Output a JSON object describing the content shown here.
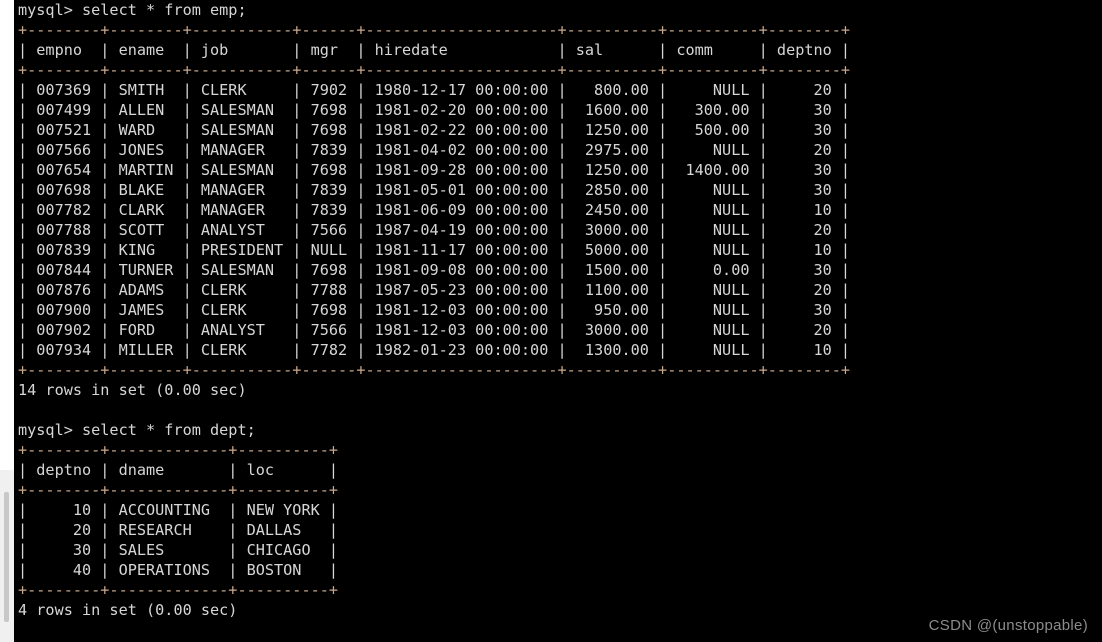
{
  "terminal": {
    "prompt": "mysql> ",
    "queries": {
      "emp": "select * from emp;",
      "dept": "select * from dept;"
    },
    "status": {
      "emp": "14 rows in set (0.00 sec)",
      "dept": "4 rows in set (0.00 sec)"
    }
  },
  "emp_table": {
    "columns": [
      "empno",
      "ename",
      "job",
      "mgr",
      "hiredate",
      "sal",
      "comm",
      "deptno"
    ],
    "widths": [
      8,
      8,
      11,
      6,
      21,
      10,
      10,
      8
    ],
    "align": [
      "right",
      "left",
      "left",
      "right",
      "left",
      "right",
      "right",
      "right"
    ],
    "rows": [
      {
        "empno": "007369",
        "ename": "SMITH",
        "job": "CLERK",
        "mgr": "7902",
        "hiredate": "1980-12-17 00:00:00",
        "sal": "800.00",
        "comm": "NULL",
        "deptno": "20"
      },
      {
        "empno": "007499",
        "ename": "ALLEN",
        "job": "SALESMAN",
        "mgr": "7698",
        "hiredate": "1981-02-20 00:00:00",
        "sal": "1600.00",
        "comm": "300.00",
        "deptno": "30"
      },
      {
        "empno": "007521",
        "ename": "WARD",
        "job": "SALESMAN",
        "mgr": "7698",
        "hiredate": "1981-02-22 00:00:00",
        "sal": "1250.00",
        "comm": "500.00",
        "deptno": "30"
      },
      {
        "empno": "007566",
        "ename": "JONES",
        "job": "MANAGER",
        "mgr": "7839",
        "hiredate": "1981-04-02 00:00:00",
        "sal": "2975.00",
        "comm": "NULL",
        "deptno": "20"
      },
      {
        "empno": "007654",
        "ename": "MARTIN",
        "job": "SALESMAN",
        "mgr": "7698",
        "hiredate": "1981-09-28 00:00:00",
        "sal": "1250.00",
        "comm": "1400.00",
        "deptno": "30"
      },
      {
        "empno": "007698",
        "ename": "BLAKE",
        "job": "MANAGER",
        "mgr": "7839",
        "hiredate": "1981-05-01 00:00:00",
        "sal": "2850.00",
        "comm": "NULL",
        "deptno": "30"
      },
      {
        "empno": "007782",
        "ename": "CLARK",
        "job": "MANAGER",
        "mgr": "7839",
        "hiredate": "1981-06-09 00:00:00",
        "sal": "2450.00",
        "comm": "NULL",
        "deptno": "10"
      },
      {
        "empno": "007788",
        "ename": "SCOTT",
        "job": "ANALYST",
        "mgr": "7566",
        "hiredate": "1987-04-19 00:00:00",
        "sal": "3000.00",
        "comm": "NULL",
        "deptno": "20"
      },
      {
        "empno": "007839",
        "ename": "KING",
        "job": "PRESIDENT",
        "mgr": "NULL",
        "hiredate": "1981-11-17 00:00:00",
        "sal": "5000.00",
        "comm": "NULL",
        "deptno": "10"
      },
      {
        "empno": "007844",
        "ename": "TURNER",
        "job": "SALESMAN",
        "mgr": "7698",
        "hiredate": "1981-09-08 00:00:00",
        "sal": "1500.00",
        "comm": "0.00",
        "deptno": "30"
      },
      {
        "empno": "007876",
        "ename": "ADAMS",
        "job": "CLERK",
        "mgr": "7788",
        "hiredate": "1987-05-23 00:00:00",
        "sal": "1100.00",
        "comm": "NULL",
        "deptno": "20"
      },
      {
        "empno": "007900",
        "ename": "JAMES",
        "job": "CLERK",
        "mgr": "7698",
        "hiredate": "1981-12-03 00:00:00",
        "sal": "950.00",
        "comm": "NULL",
        "deptno": "30"
      },
      {
        "empno": "007902",
        "ename": "FORD",
        "job": "ANALYST",
        "mgr": "7566",
        "hiredate": "1981-12-03 00:00:00",
        "sal": "3000.00",
        "comm": "NULL",
        "deptno": "20"
      },
      {
        "empno": "007934",
        "ename": "MILLER",
        "job": "CLERK",
        "mgr": "7782",
        "hiredate": "1982-01-23 00:00:00",
        "sal": "1300.00",
        "comm": "NULL",
        "deptno": "10"
      }
    ]
  },
  "dept_table": {
    "columns": [
      "deptno",
      "dname",
      "loc"
    ],
    "widths": [
      8,
      13,
      10
    ],
    "align": [
      "right",
      "left",
      "left"
    ],
    "rows": [
      {
        "deptno": "10",
        "dname": "ACCOUNTING",
        "loc": "NEW YORK"
      },
      {
        "deptno": "20",
        "dname": "RESEARCH",
        "loc": "DALLAS"
      },
      {
        "deptno": "30",
        "dname": "SALES",
        "loc": "CHICAGO"
      },
      {
        "deptno": "40",
        "dname": "OPERATIONS",
        "loc": "BOSTON"
      }
    ]
  },
  "watermark": {
    "text": "CSDN @(unstoppable)"
  },
  "colors": {
    "background": "#000000",
    "text": "#d6d6d6",
    "rule": "#c9a88a",
    "watermark": "#8c8c8c",
    "chrome_white": "#ffffff",
    "chrome_grey": "#f0f0f0"
  }
}
